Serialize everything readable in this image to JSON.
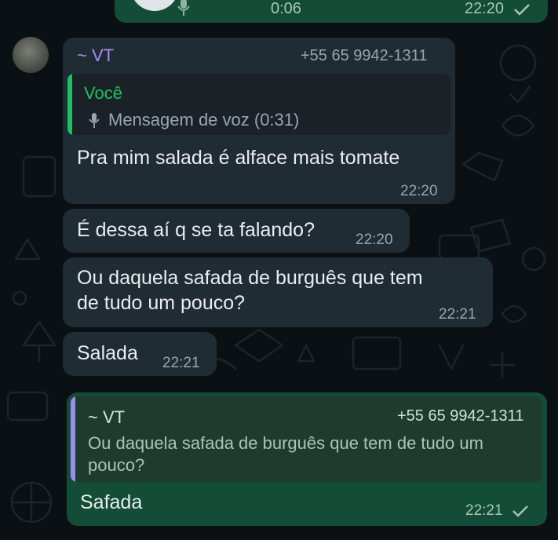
{
  "colors": {
    "background": "#0b1014",
    "incoming_bubble": "#202c33",
    "outgoing_bubble": "#144d37",
    "sender_name": "#a78bfa",
    "quote_you": "#21c063",
    "quote_other": "#9b8cf0"
  },
  "top_voice": {
    "duration": "0:06",
    "time": "22:20",
    "status_icon": "single-check-icon"
  },
  "group_msg": {
    "sender_name": "~ VT",
    "sender_phone": "+55 65 9942-1311",
    "quote_author": "Você",
    "quote_icon": "mic-icon",
    "quote_text": "Mensagem de voz (0:31)",
    "text": "Pra mim salada é alface mais tomate",
    "time": "22:20"
  },
  "msg2": {
    "text": "É dessa aí q se ta falando?",
    "time": "22:20"
  },
  "msg3": {
    "line1": "Ou daquela safada de burguês que tem",
    "line2": "de tudo um pouco?",
    "time": "22:21"
  },
  "msg4": {
    "text": "Salada",
    "time": "22:21"
  },
  "out_msg": {
    "quote_name": "~ VT",
    "quote_phone": "+55 65 9942-1311",
    "quote_line1": "Ou daquela safada de burguês que tem de tudo um",
    "quote_line2": "pouco?",
    "text": "Safada",
    "time": "22:21",
    "status_icon": "single-check-icon"
  }
}
